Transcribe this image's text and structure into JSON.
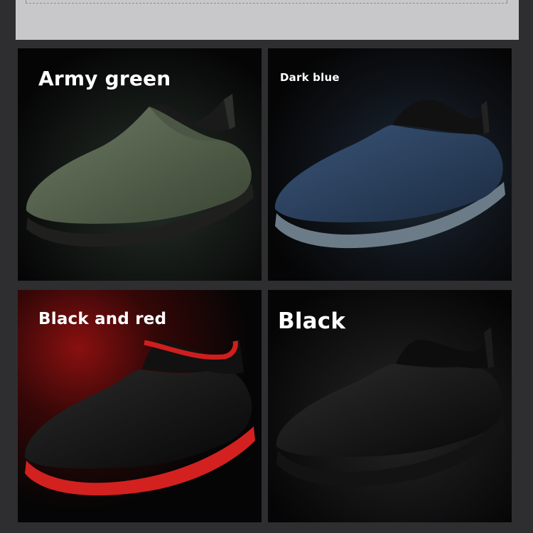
{
  "variants": [
    {
      "label": "Army green",
      "upper": "#5d6a55",
      "upper_dark": "#37402f",
      "sole": "#2a2a28",
      "collar": "#1a1a1a",
      "lining": "#161616",
      "glow": "#1e2420"
    },
    {
      "label": "Dark blue",
      "upper": "#2d4463",
      "upper_dark": "#1a2a40",
      "sole": "#5f6f7b",
      "collar": "#111111",
      "lining": "#121212",
      "glow": "#1b2430"
    },
    {
      "label": "Black and red",
      "upper": "#1b1b1b",
      "upper_dark": "#050505",
      "sole": "#c8201f",
      "collar": "#111111",
      "lining": "#d01e1e",
      "glow": "#7d0f0f"
    },
    {
      "label": "Black",
      "upper": "#1c1c1c",
      "upper_dark": "#050505",
      "sole": "#151515",
      "collar": "#0d0d0d",
      "lining": "#111111",
      "glow": "#2a2a2a"
    }
  ]
}
